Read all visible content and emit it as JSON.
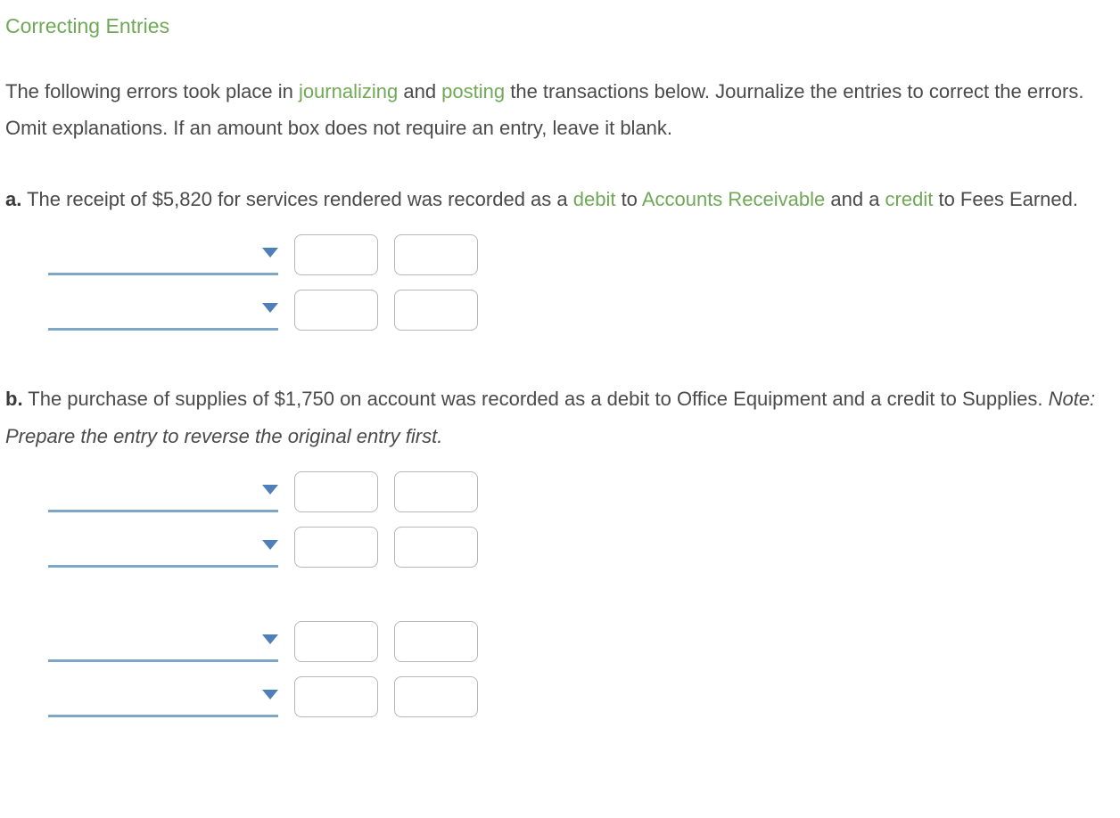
{
  "title": "Correcting Entries",
  "intro": {
    "part1": "The following errors took place in ",
    "link1": "journalizing",
    "part2": " and ",
    "link2": "posting",
    "part3": " the transactions below. Journalize the entries to correct the errors. Omit explanations. If an amount box does not require an entry, leave it blank."
  },
  "problem_a": {
    "label": "a.",
    "part1": "  The receipt of $5,820 for services rendered was recorded as a ",
    "link1": "debit",
    "part2": " to ",
    "link2": "Accounts Receivable",
    "part3": " and a ",
    "link3": "credit",
    "part4": " to Fees Earned."
  },
  "problem_b": {
    "label": "b.",
    "part1": "  The purchase of supplies of $1,750 on account was recorded as a debit to Office Equipment and a credit to Supplies. ",
    "note": "Note: Prepare the entry to reverse the original entry first."
  }
}
